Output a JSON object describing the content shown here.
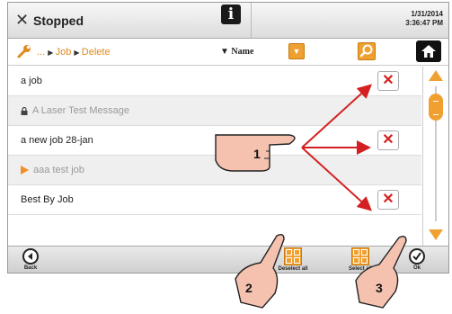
{
  "titlebar": {
    "close_icon": "close-icon",
    "title": "Stopped",
    "info_icon": "info-icon",
    "info_text": "i",
    "date": "1/31/2014",
    "time": "3:36:47 PM"
  },
  "navbar": {
    "wrench_icon": "wrench-icon",
    "breadcrumb": [
      "...",
      "Job",
      "Delete"
    ],
    "sort_label": "Name",
    "sort_dropdown_icon": "chevron-down-icon",
    "search_icon": "search-icon",
    "home_icon": "home-icon"
  },
  "jobs": [
    {
      "name": "a job",
      "state": "normal",
      "deletable": true
    },
    {
      "name": "A Laser Test Message",
      "state": "locked",
      "deletable": false
    },
    {
      "name": "a new job 28-jan",
      "state": "normal",
      "deletable": true
    },
    {
      "name": "aaa test job",
      "state": "current",
      "deletable": false
    },
    {
      "name": "Best By Job",
      "state": "normal",
      "deletable": true
    }
  ],
  "delete_icon": "close-icon",
  "bottombar": {
    "back_label": "Back",
    "deselect_all_label": "Deselect all",
    "select_all_label": "Select all",
    "ok_label": "Ok"
  },
  "callouts": [
    "1",
    "2",
    "3"
  ],
  "colors": {
    "accent": "#f0a030",
    "delete": "#d82020",
    "arrow": "#d42020",
    "hand": "#f5c2b0"
  }
}
